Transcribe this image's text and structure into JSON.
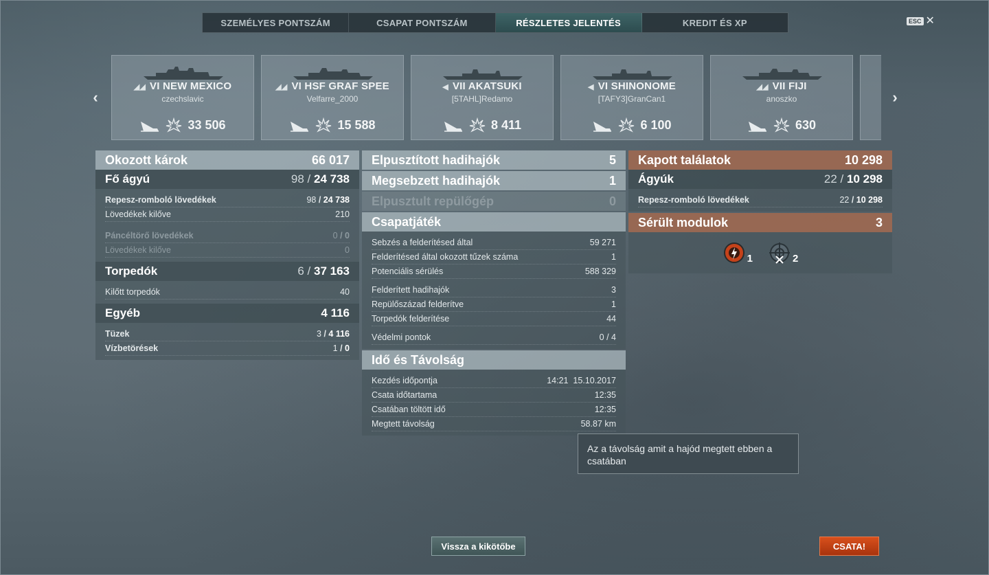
{
  "tabs": [
    "SZEMÉLYES PONTSZÁM",
    "CSAPAT PONTSZÁM",
    "RÉSZLETES JELENTÉS",
    "KREDIT ÉS XP"
  ],
  "active_tab": 2,
  "esc_label": "ESC",
  "close_glyph": "✕",
  "carousel": {
    "prev_glyph": "‹",
    "next_glyph": "›",
    "cards": [
      {
        "tier": "VI",
        "name": "NEW MEXICO",
        "player": "czechslavic",
        "damage": "33 506"
      },
      {
        "tier": "VI",
        "name": "HSF GRAF SPEE",
        "player": "Velfarre_2000",
        "damage": "15 588"
      },
      {
        "tier": "VII",
        "name": "AKATSUKI",
        "player": "[5TAHL]Redamo",
        "damage": "8 411"
      },
      {
        "tier": "VI",
        "name": "SHINONOME",
        "player": "[TAFY3]GranCan1",
        "damage": "6 100"
      },
      {
        "tier": "VII",
        "name": "FIJI",
        "player": "anoszko",
        "damage": "630"
      }
    ]
  },
  "left": {
    "header": {
      "label": "Okozott károk",
      "value": "66 017"
    },
    "main_guns": {
      "label": "Fő ágyú",
      "hits": "98",
      "total": "24 738"
    },
    "he": {
      "label": "Repesz-romboló lövedékek",
      "hits": "98",
      "total": "24 738"
    },
    "he_fired": {
      "label": "Lövedékek kilőve",
      "value": "210"
    },
    "ap": {
      "label": "Páncéltörő lövedékek",
      "hits": "0",
      "total": "0"
    },
    "ap_fired": {
      "label": "Lövedékek kilőve",
      "value": "0"
    },
    "torpedoes": {
      "label": "Torpedók",
      "hits": "6",
      "total": "37 163"
    },
    "torps_fired": {
      "label": "Kilőtt torpedók",
      "value": "40"
    },
    "other": {
      "label": "Egyéb",
      "value": "4 116"
    },
    "fires": {
      "label": "Tüzek",
      "hits": "3",
      "total": "4 116"
    },
    "floods": {
      "label": "Vízbetörések",
      "hits": "1",
      "total": "0"
    }
  },
  "middle": {
    "destroyed": {
      "label": "Elpusztított hadihajók",
      "value": "5"
    },
    "damaged": {
      "label": "Megsebzett hadihajók",
      "value": "1"
    },
    "planes": {
      "label": "Elpusztult repülőgép",
      "value": "0"
    },
    "team_header": "Csapatjáték",
    "team_rows": [
      {
        "label": "Sebzés a felderítésed által",
        "value": "59 271"
      },
      {
        "label": "Felderítésed által okozott tűzek száma",
        "value": "1"
      },
      {
        "label": "Potenciális sérülés",
        "value": "588 329"
      },
      {
        "label": "Felderített hadihajók",
        "value": "3"
      },
      {
        "label": "Repülőszázad felderítve",
        "value": "1"
      },
      {
        "label": "Torpedók felderítése",
        "value": "44"
      },
      {
        "label": "Védelmi pontok",
        "value": "0 / 4"
      }
    ],
    "time_header": "Idő és Távolság",
    "time_rows": [
      {
        "label": "Kezdés időpontja",
        "value": "14:21  15.10.2017"
      },
      {
        "label": "Csata időtartama",
        "value": "12:35"
      },
      {
        "label": "Csatában töltött idő",
        "value": "12:35"
      },
      {
        "label": "Megtett távolság",
        "value": "58.87 km"
      }
    ]
  },
  "right": {
    "received": {
      "label": "Kapott találatok",
      "value": "10 298"
    },
    "guns": {
      "label": "Ágyúk",
      "hits": "22",
      "total": "10 298"
    },
    "he": {
      "label": "Repesz-romboló lövedékek",
      "hits": "22",
      "total": "10 298"
    },
    "modules": {
      "label": "Sérült modulok",
      "value": "3"
    },
    "module_icons": [
      {
        "icon": "engine-damaged-icon",
        "count": "1"
      },
      {
        "icon": "steering-destroyed-icon",
        "count": "2"
      }
    ]
  },
  "tooltip": "Az a távolság amit a hajód megtett ebben a csatában",
  "buttons": {
    "back": "Vissza a kikötőbe",
    "battle": "CSATA!"
  },
  "colors": {
    "accent_orange": "#c5421a",
    "received_header": "#a0694f",
    "active_tab": "#3e6466"
  }
}
